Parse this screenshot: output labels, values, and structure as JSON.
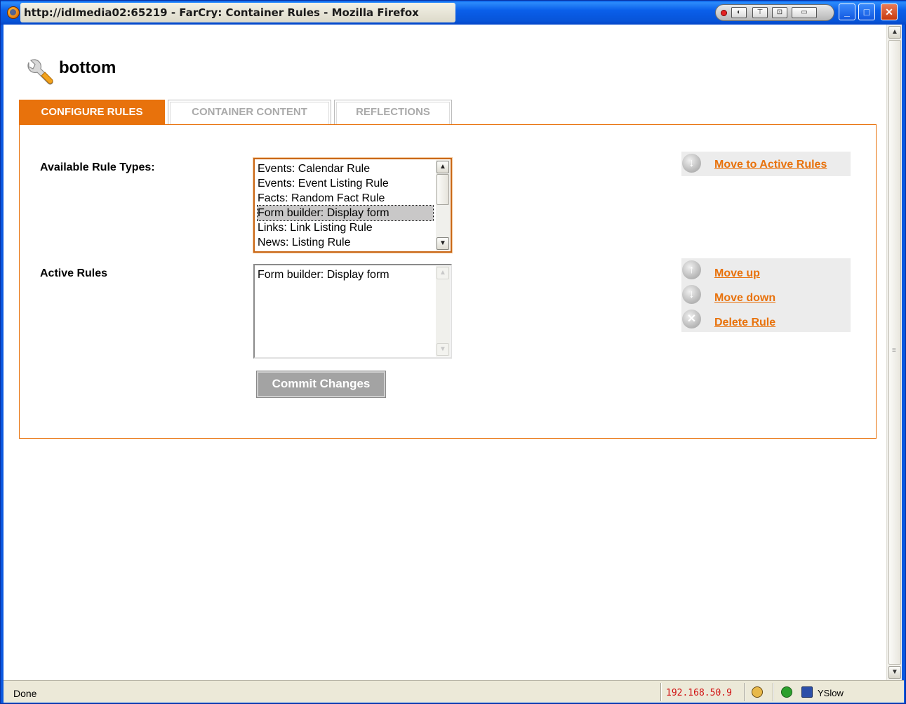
{
  "window": {
    "title": "http://idlmedia02:65219 - FarCry: Container Rules - Mozilla Firefox",
    "minimize_glyph": "_",
    "maximize_glyph": "□",
    "close_glyph": "✕",
    "tool_icons": [
      "lock-icon",
      "download-icon",
      "window-icon",
      "screen-icon"
    ]
  },
  "page": {
    "title": "bottom",
    "icon": "wrench-icon"
  },
  "tabs": [
    {
      "label": "CONFIGURE RULES",
      "active": true
    },
    {
      "label": "CONTAINER CONTENT",
      "active": false
    },
    {
      "label": "REFLECTIONS",
      "active": false
    }
  ],
  "available": {
    "label": "Available Rule Types:",
    "items": [
      "Events: Calendar Rule",
      "Events: Event Listing Rule",
      "Facts: Random Fact Rule",
      "Form builder: Display form",
      "Links: Link Listing Rule",
      "News: Listing Rule"
    ],
    "selected_index": 3,
    "move_label": "Move to Active Rules"
  },
  "active": {
    "label": "Active Rules",
    "items": [
      "Form builder: Display form"
    ],
    "move_up_label": "Move up",
    "move_down_label": "Move down",
    "delete_label": "Delete Rule"
  },
  "commit_label": "Commit Changes",
  "status": {
    "text": "Done",
    "ip": "192.168.50.9",
    "yslow": "YSlow"
  },
  "colors": {
    "accent": "#e8720c",
    "xp_blue": "#0a58e0",
    "status_ip": "#d01010"
  }
}
